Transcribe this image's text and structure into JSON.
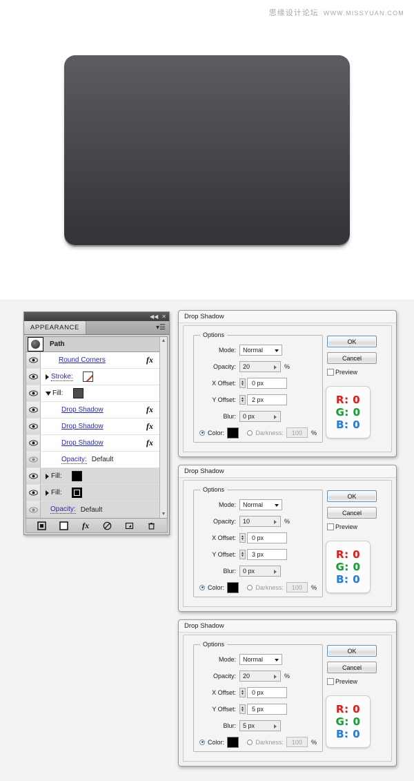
{
  "watermark": {
    "cn": "思缘设计论坛",
    "url": "WWW.MISSYUAN.COM"
  },
  "artwork": {
    "name": "rounded-rectangle-gradient",
    "gradient_top": "#5b5d63",
    "gradient_bottom": "#323438",
    "corner_radius": "16px"
  },
  "panel": {
    "tab_label": "APPEARANCE",
    "collapse_icon": "◀◀",
    "close_icon": "✕",
    "menu_icon": "▾☰",
    "scroll_up": "▲",
    "scroll_down": "▼",
    "rows": [
      {
        "type": "header",
        "label": "Path",
        "thumb": "path-thumbnail",
        "eye": false,
        "fx": false,
        "shaded": true
      },
      {
        "type": "effect",
        "label": "Round Corners",
        "style": "link",
        "eye": true,
        "fx": true,
        "indent": 1
      },
      {
        "type": "stroke",
        "label": "Stroke:",
        "style": "dotted",
        "eye": true,
        "fx": false,
        "indent": 1,
        "disclosure": "closed",
        "swatch": "none"
      },
      {
        "type": "fill",
        "label": "Fill:",
        "style": "plain",
        "eye": true,
        "fx": false,
        "indent": 1,
        "disclosure": "open",
        "swatch": "gray"
      },
      {
        "type": "effect",
        "label": "Drop Shadow",
        "style": "link",
        "eye": true,
        "fx": true,
        "indent": 2
      },
      {
        "type": "effect",
        "label": "Drop Shadow",
        "style": "link",
        "eye": true,
        "fx": true,
        "indent": 2
      },
      {
        "type": "effect",
        "label": "Drop Shadow",
        "style": "link",
        "eye": true,
        "fx": true,
        "indent": 2
      },
      {
        "type": "opacity",
        "label": "Opacity:",
        "value": "Default",
        "style": "dotted",
        "eye": true,
        "fx": false,
        "indent": 2
      },
      {
        "type": "fill",
        "label": "Fill:",
        "style": "plain",
        "eye": true,
        "fx": false,
        "indent": 1,
        "disclosure": "closed",
        "swatch": "black",
        "shaded": true
      },
      {
        "type": "fill",
        "label": "Fill:",
        "style": "plain",
        "eye": true,
        "fx": false,
        "indent": 1,
        "disclosure": "closed",
        "swatch": "blackb",
        "shaded": true
      },
      {
        "type": "opacity",
        "label": "Opacity:",
        "value": "Default",
        "style": "dotted",
        "eye": true,
        "fx": false,
        "indent": 1,
        "shaded": true
      }
    ],
    "footer_icons": [
      "add-new-stroke-icon",
      "add-new-fill-icon",
      "add-new-effect-icon",
      "clear-appearance-icon",
      "duplicate-item-icon",
      "delete-item-icon"
    ]
  },
  "dialogs": [
    {
      "title": "Drop Shadow",
      "legend": "Options",
      "mode_label": "Mode:",
      "mode_value": "Normal",
      "opacity_label": "Opacity:",
      "opacity_value": "20",
      "opacity_unit": "%",
      "xoffset_label": "X Offset:",
      "xoffset_value": "0 px",
      "yoffset_label": "Y Offset:",
      "yoffset_value": "2 px",
      "blur_label": "Blur:",
      "blur_value": "0 px",
      "color_label": "Color:",
      "color_value": "#000000",
      "darkness_label": "Darkness:",
      "darkness_value": "100",
      "darkness_unit": "%",
      "ok_label": "OK",
      "cancel_label": "Cancel",
      "preview_label": "Preview",
      "rgb": {
        "r": "R: 0",
        "g": "G: 0",
        "b": "B: 0"
      }
    },
    {
      "title": "Drop Shadow",
      "legend": "Options",
      "mode_label": "Mode:",
      "mode_value": "Normal",
      "opacity_label": "Opacity:",
      "opacity_value": "10",
      "opacity_unit": "%",
      "xoffset_label": "X Offset:",
      "xoffset_value": "0 px",
      "yoffset_label": "Y Offset:",
      "yoffset_value": "3 px",
      "blur_label": "Blur:",
      "blur_value": "0 px",
      "color_label": "Color:",
      "color_value": "#000000",
      "darkness_label": "Darkness:",
      "darkness_value": "100",
      "darkness_unit": "%",
      "ok_label": "OK",
      "cancel_label": "Cancel",
      "preview_label": "Preview",
      "rgb": {
        "r": "R: 0",
        "g": "G: 0",
        "b": "B: 0"
      }
    },
    {
      "title": "Drop Shadow",
      "legend": "Options",
      "mode_label": "Mode:",
      "mode_value": "Normal",
      "opacity_label": "Opacity:",
      "opacity_value": "20",
      "opacity_unit": "%",
      "xoffset_label": "X Offset:",
      "xoffset_value": "0 px",
      "yoffset_label": "Y Offset:",
      "yoffset_value": "5 px",
      "blur_label": "Blur:",
      "blur_value": "5 px",
      "color_label": "Color:",
      "color_value": "#000000",
      "darkness_label": "Darkness:",
      "darkness_value": "100",
      "darkness_unit": "%",
      "ok_label": "OK",
      "cancel_label": "Cancel",
      "preview_label": "Preview",
      "rgb": {
        "r": "R: 0",
        "g": "G: 0",
        "b": "B: 0"
      }
    }
  ]
}
